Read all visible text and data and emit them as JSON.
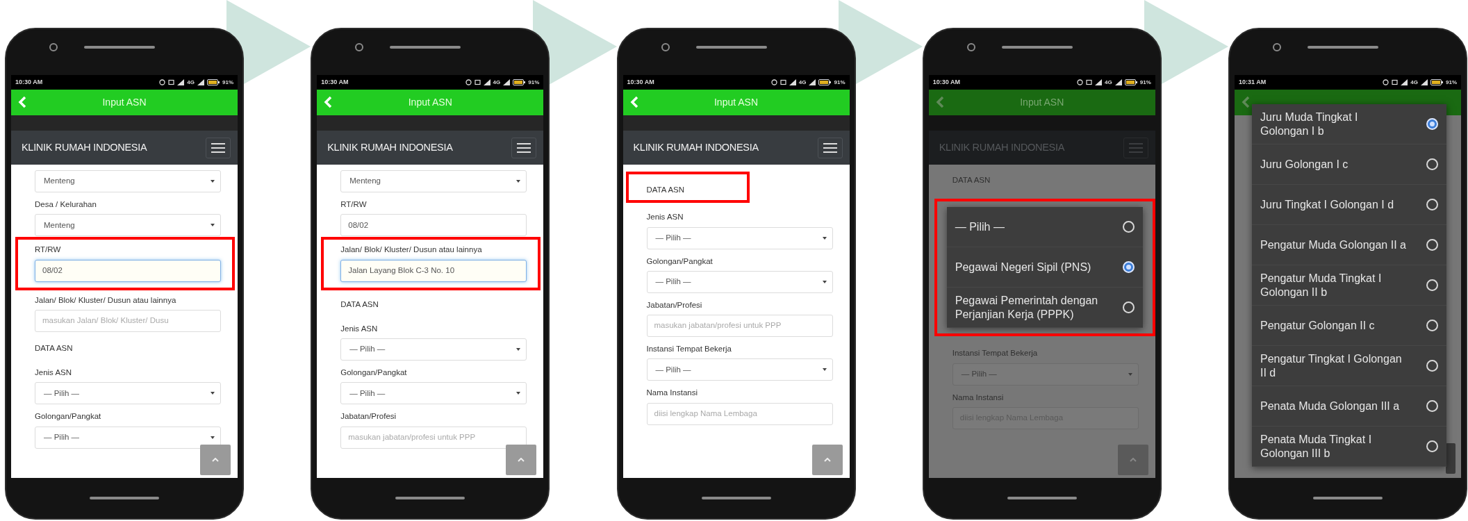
{
  "steps": [
    {
      "status_bar": {
        "time": "10:30 AM",
        "network": "4G",
        "battery": "91%"
      },
      "app_bar": {
        "title": "Input ASN"
      },
      "site_header": {
        "brand": "KLINIK RUMAH INDONESIA"
      },
      "dimmed": false,
      "scroll_top_button": true,
      "form": [
        {
          "kind": "select",
          "value": "Menteng"
        },
        {
          "kind": "select",
          "label": "Desa / Kelurahan",
          "value": "Menteng"
        },
        {
          "kind": "input",
          "label": "RT/RW",
          "value": "08/02",
          "focused": true,
          "highlighted": true
        },
        {
          "kind": "input",
          "label": "Jalan/ Blok/ Kluster/ Dusun atau lainnya",
          "placeholder": "masukan Jalan/ Blok/ Kluster/ Dusu",
          "focused": false
        },
        {
          "kind": "heading",
          "text": "DATA ASN"
        },
        {
          "kind": "select",
          "label": "Jenis ASN",
          "value": "— Pilih —"
        },
        {
          "kind": "select",
          "label": "Golongan/Pangkat",
          "value": "— Pilih —"
        }
      ]
    },
    {
      "status_bar": {
        "time": "10:30 AM",
        "network": "4G",
        "battery": "91%"
      },
      "app_bar": {
        "title": "Input ASN"
      },
      "site_header": {
        "brand": "KLINIK RUMAH INDONESIA"
      },
      "dimmed": false,
      "scroll_top_button": true,
      "form": [
        {
          "kind": "select",
          "value": "Menteng"
        },
        {
          "kind": "input",
          "label": "RT/RW",
          "value": "08/02",
          "focused": false
        },
        {
          "kind": "input",
          "label": "Jalan/ Blok/ Kluster/ Dusun atau lainnya",
          "value": "Jalan Layang Blok C-3 No. 10",
          "focused": true,
          "highlighted": true
        },
        {
          "kind": "heading",
          "text": "DATA ASN"
        },
        {
          "kind": "select",
          "label": "Jenis ASN",
          "value": "— Pilih —"
        },
        {
          "kind": "select",
          "label": "Golongan/Pangkat",
          "value": "— Pilih —"
        },
        {
          "kind": "input",
          "label": "Jabatan/Profesi",
          "placeholder": "masukan jabatan/profesi untuk PPP",
          "focused": false
        }
      ]
    },
    {
      "status_bar": {
        "time": "10:30 AM",
        "network": "4G",
        "battery": "91%"
      },
      "app_bar": {
        "title": "Input ASN"
      },
      "site_header": {
        "brand": "KLINIK RUMAH INDONESIA"
      },
      "dimmed": false,
      "scroll_top_button": true,
      "form": [
        {
          "kind": "heading",
          "text": "DATA ASN",
          "highlighted": true
        },
        {
          "kind": "select",
          "label": "Jenis ASN",
          "value": "— Pilih —"
        },
        {
          "kind": "select",
          "label": "Golongan/Pangkat",
          "value": "— Pilih —"
        },
        {
          "kind": "input",
          "label": "Jabatan/Profesi",
          "placeholder": "masukan jabatan/profesi untuk PPP",
          "focused": false
        },
        {
          "kind": "select",
          "label": "Instansi Tempat Bekerja",
          "value": "— Pilih —"
        },
        {
          "kind": "input",
          "label": "Nama Instansi",
          "placeholder": "diisi lengkap Nama Lembaga",
          "focused": false
        }
      ]
    },
    {
      "status_bar": {
        "time": "10:30 AM",
        "network": "4G",
        "battery": "91%"
      },
      "app_bar": {
        "title": "Input ASN"
      },
      "site_header": {
        "brand": "KLINIK RUMAH INDONESIA"
      },
      "dimmed": true,
      "scroll_top_button": true,
      "form": [
        {
          "kind": "heading",
          "text": "DATA ASN"
        },
        {
          "kind": "dialog",
          "highlighted": true,
          "options": [
            {
              "label": "— Pilih —",
              "selected": false
            },
            {
              "label": "Pegawai Negeri Sipil (PNS)",
              "selected": true
            },
            {
              "label": "Pegawai Pemerintah dengan Perjanjian Kerja (PPPK)",
              "selected": false
            }
          ]
        },
        {
          "kind": "select",
          "label": "Instansi Tempat Bekerja",
          "value": "— Pilih —"
        },
        {
          "kind": "input",
          "label": "Nama Instansi",
          "placeholder": "diisi lengkap Nama Lembaga",
          "focused": false
        }
      ]
    },
    {
      "status_bar": {
        "time": "10:31 AM",
        "network": "4G",
        "battery": "91%"
      },
      "dimmed": true,
      "scroll_top_button": true,
      "dialog": {
        "options": [
          {
            "label": "Juru Muda Tingkat I Golongan I b",
            "selected": true
          },
          {
            "label": "Juru Golongan I c",
            "selected": false
          },
          {
            "label": "Juru Tingkat I Golongan I d",
            "selected": false
          },
          {
            "label": "Pengatur Muda Golongan II a",
            "selected": false
          },
          {
            "label": "Pengatur Muda Tingkat I Golongan II b",
            "selected": false
          },
          {
            "label": "Pengatur Golongan II c",
            "selected": false
          },
          {
            "label": "Pengatur Tingkat I Golongan II d",
            "selected": false
          },
          {
            "label": "Penata Muda Golongan III a",
            "selected": false
          },
          {
            "label": "Penata Muda Tingkat I Golongan III b",
            "selected": false
          }
        ]
      }
    }
  ]
}
